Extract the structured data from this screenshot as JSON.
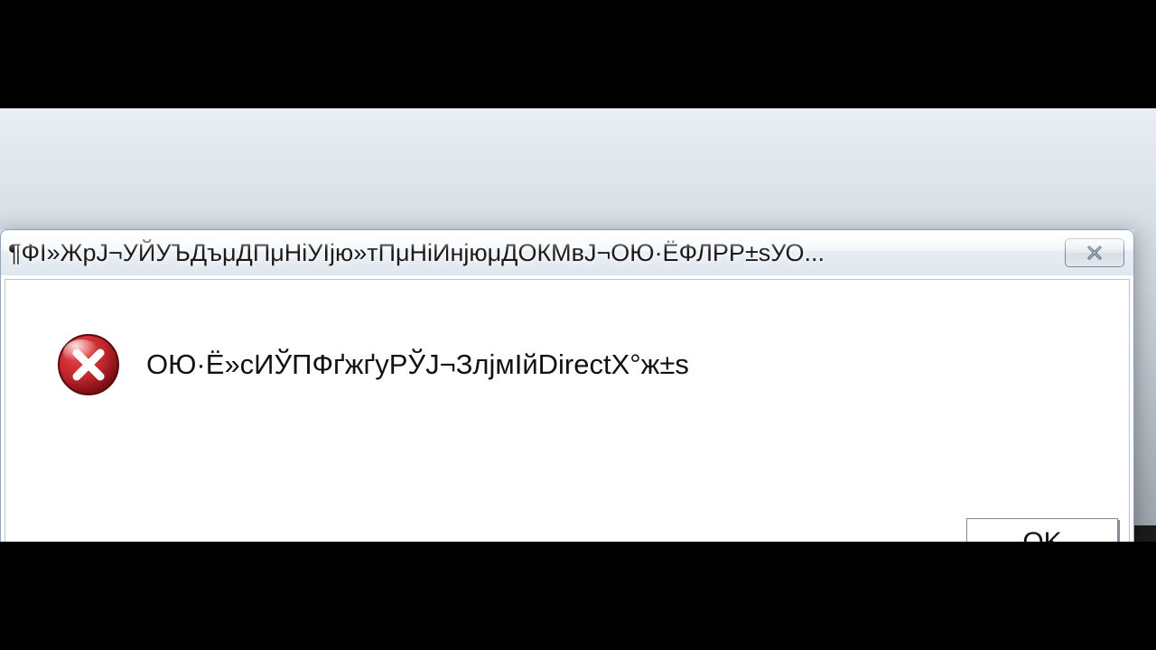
{
  "dialog": {
    "title": "¶ФІ»ЖрЈ¬УЙУЪДъμДПμНіУІјю»тПμНіИнјюμДОКМвЈ¬ОЮ·ЁФЛРР±ѕУО...",
    "message": "ОЮ·Ё»сИЎПФґжґуРЎЈ¬ЗлјмІйDirectX°ж±ѕ",
    "ok_label": "OK",
    "icon_name": "error-icon",
    "close_name": "close-icon"
  },
  "colors": {
    "error_red": "#c1272d",
    "error_red_dark": "#7a0e12"
  }
}
